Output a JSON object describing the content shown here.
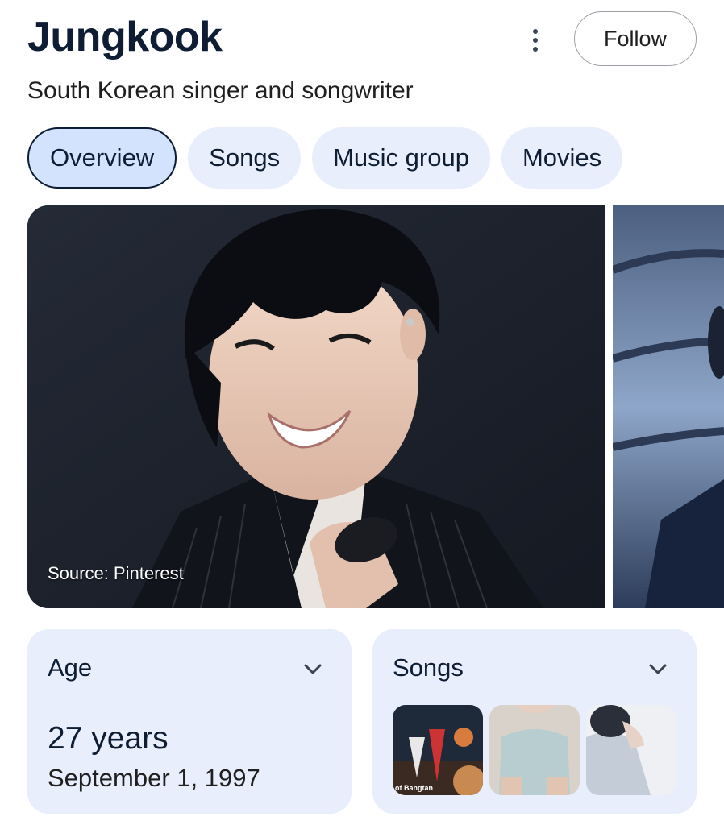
{
  "header": {
    "title": "Jungkook",
    "subtitle": "South Korean singer and songwriter",
    "follow_label": "Follow"
  },
  "tabs": [
    {
      "label": "Overview",
      "active": true
    },
    {
      "label": "Songs",
      "active": false
    },
    {
      "label": "Music group",
      "active": false
    },
    {
      "label": "Movies",
      "active": false
    }
  ],
  "images": {
    "source_label": "Source: Pinterest"
  },
  "cards": {
    "age": {
      "title": "Age",
      "value": "27 years",
      "date": "September 1, 1997"
    },
    "songs": {
      "title": "Songs",
      "thumb_caption": "of Bangtan"
    }
  },
  "colors": {
    "chip_bg": "#e8eefc",
    "chip_active_bg": "#d3e3fd",
    "title": "#0e1d33"
  }
}
